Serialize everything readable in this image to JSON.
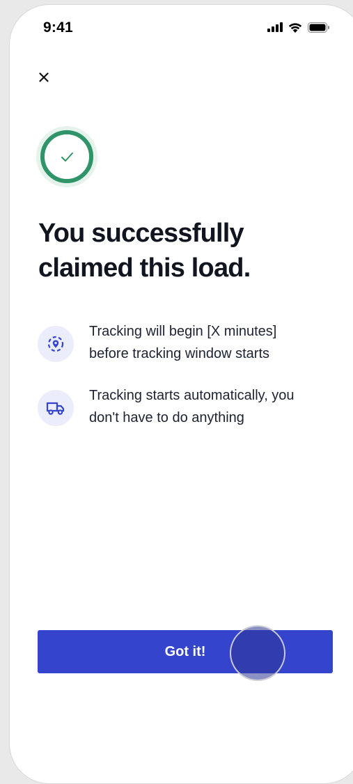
{
  "status_bar": {
    "time": "9:41",
    "icons": [
      "signal-icon",
      "wifi-icon",
      "battery-icon"
    ]
  },
  "header": {
    "close_icon": "close-icon"
  },
  "success": {
    "icon": "check-circle-icon",
    "accent_color": "#2f9467",
    "title_line1": "You successfully",
    "title_line2": "claimed this load."
  },
  "info_items": [
    {
      "icon": "location-tracking-icon",
      "line1": "Tracking will begin [X minutes]",
      "line2": "before tracking window starts"
    },
    {
      "icon": "truck-icon",
      "line1": "Tracking starts automatically, you",
      "line2": "don't have to do anything"
    }
  ],
  "footer": {
    "primary_label": "Got it!",
    "primary_color": "#3544cc"
  }
}
